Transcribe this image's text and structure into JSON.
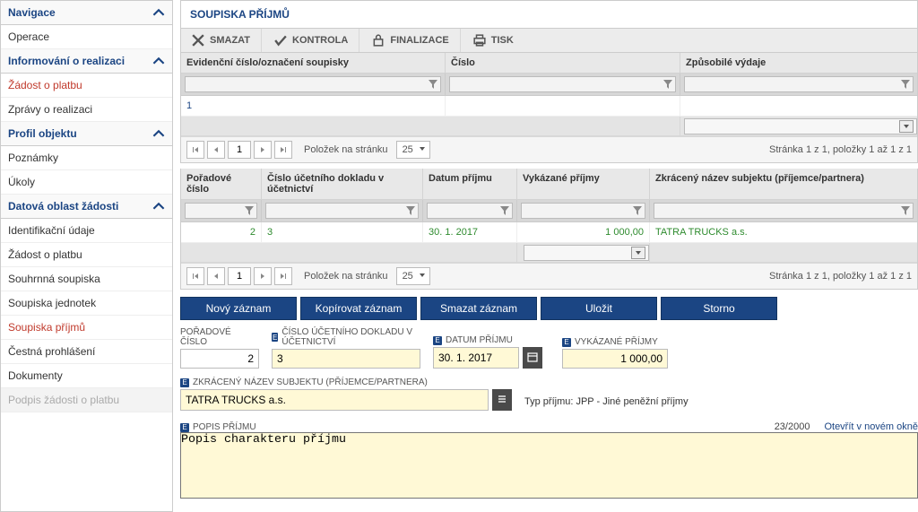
{
  "sidebar": {
    "groups": [
      {
        "title": "Navigace",
        "items": [
          {
            "label": "Operace"
          }
        ]
      },
      {
        "title": "Informování o realizaci",
        "items": [
          {
            "label": "Žádost o platbu",
            "style": "red"
          },
          {
            "label": "Zprávy o realizaci"
          }
        ]
      },
      {
        "title": "Profil objektu",
        "items": [
          {
            "label": "Poznámky"
          },
          {
            "label": "Úkoly"
          }
        ]
      },
      {
        "title": "Datová oblast žádosti",
        "items": [
          {
            "label": "Identifikační údaje"
          },
          {
            "label": "Žádost o platbu"
          },
          {
            "label": "Souhrnná soupiska"
          },
          {
            "label": "Soupiska jednotek"
          },
          {
            "label": "Soupiska příjmů",
            "style": "red"
          },
          {
            "label": "Čestná prohlášení"
          },
          {
            "label": "Dokumenty"
          },
          {
            "label": "Podpis žádosti o platbu",
            "style": "disabled"
          }
        ]
      }
    ]
  },
  "page": {
    "title": "SOUPISKA PŘÍJMŮ"
  },
  "toolbar": {
    "delete": "SMAZAT",
    "check": "KONTROLA",
    "finalize": "FINALIZACE",
    "print": "TISK"
  },
  "grid1": {
    "headers": {
      "c1": "Evidenční číslo/označení soupisky",
      "c2": "Číslo",
      "c3": "Způsobilé výdaje"
    },
    "row": {
      "c1": "1",
      "c2": "",
      "c3": ""
    },
    "pager": {
      "label": "Položek na stránku",
      "size": "25",
      "page": "1",
      "status": "Stránka 1 z 1, položky 1 až 1 z 1"
    }
  },
  "grid2": {
    "headers": {
      "c1": "Pořadové číslo",
      "c2": "Číslo účetního dokladu v účetnictví",
      "c3": "Datum příjmu",
      "c4": "Vykázané příjmy",
      "c5": "Zkrácený název subjektu (příjemce/partnera)"
    },
    "row": {
      "c1": "2",
      "c2": "3",
      "c3": "30. 1. 2017",
      "c4": "1 000,00",
      "c5": "TATRA TRUCKS a.s."
    },
    "pager": {
      "label": "Položek na stránku",
      "size": "25",
      "page": "1",
      "status": "Stránka 1 z 1, položky 1 až 1 z 1"
    }
  },
  "actions": {
    "new": "Nový záznam",
    "copy": "Kopírovat záznam",
    "delete": "Smazat záznam",
    "save": "Uložit",
    "cancel": "Storno"
  },
  "form": {
    "poradove": {
      "label": "POŘADOVÉ ČÍSLO",
      "value": "2"
    },
    "doklad": {
      "label": "ČÍSLO ÚČETNÍHO DOKLADU V ÚČETNICTVÍ",
      "value": "3"
    },
    "datum": {
      "label": "DATUM PŘÍJMU",
      "value": "30. 1. 2017"
    },
    "vykazane": {
      "label": "VYKÁZANÉ PŘÍJMY",
      "value": "1 000,00"
    },
    "subjekt": {
      "label": "ZKRÁCENÝ NÁZEV SUBJEKTU (PŘÍJEMCE/PARTNERA)",
      "value": "TATRA TRUCKS a.s."
    },
    "typ": {
      "text": "Typ příjmu: JPP - Jiné peněžní příjmy"
    },
    "popis": {
      "label": "POPIS PŘÍJMU",
      "value": "Popis charakteru příjmu",
      "count": "23/2000",
      "link": "Otevřít v novém okně"
    }
  }
}
